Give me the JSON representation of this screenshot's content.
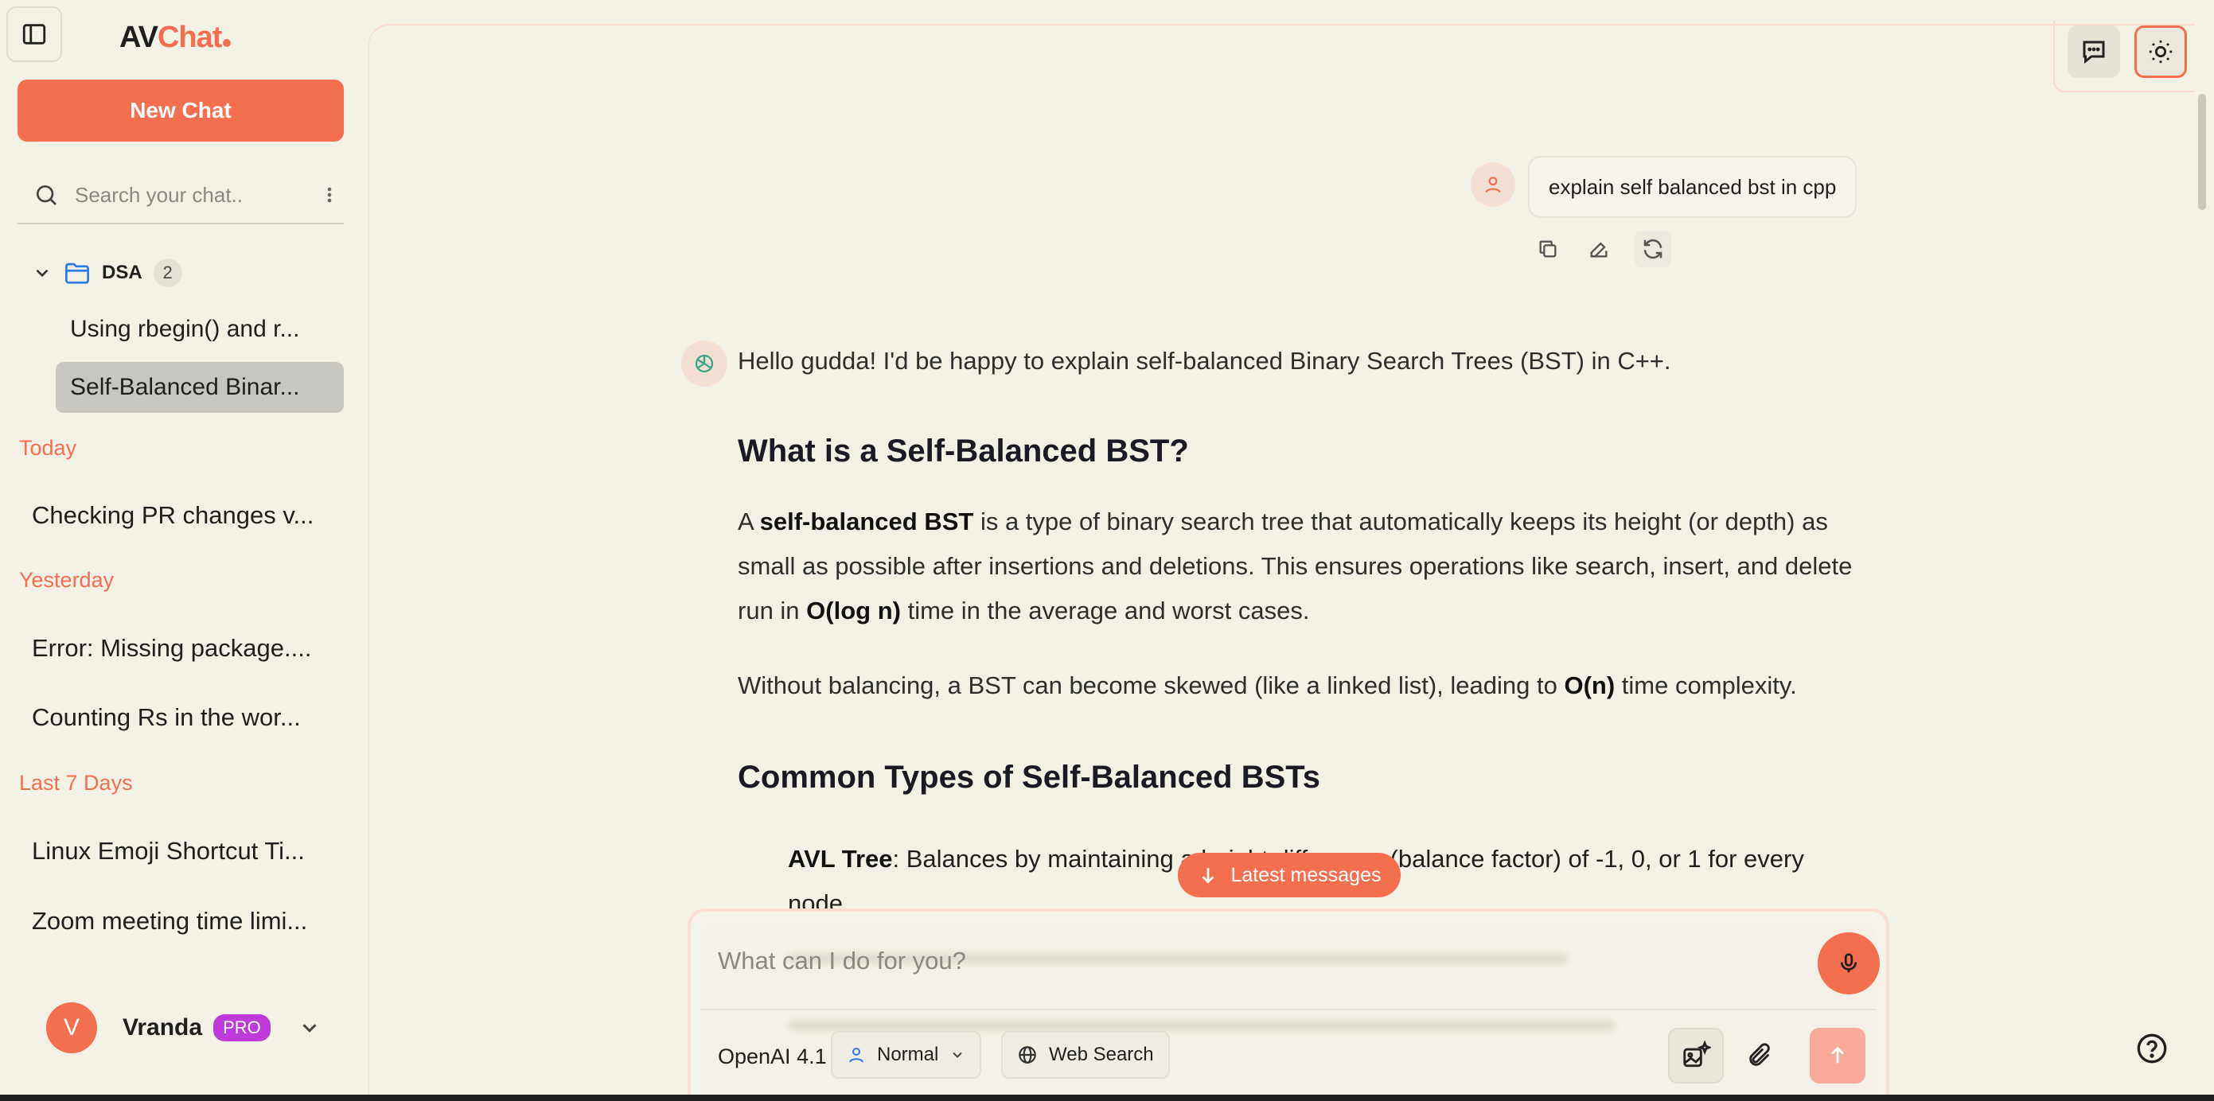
{
  "sidebar": {
    "logo_main": "AV",
    "logo_accent": "Chat",
    "new_chat_label": "New Chat",
    "search_placeholder": "Search your chat..",
    "folder": {
      "label": "DSA",
      "count": "2",
      "items": [
        {
          "label": "Using rbegin() and r..."
        },
        {
          "label": "Self-Balanced Binar..."
        }
      ]
    },
    "sections": [
      {
        "label": "Today",
        "items": [
          "Checking PR changes v..."
        ]
      },
      {
        "label": "Yesterday",
        "items": [
          "Error: Missing package....",
          "Counting Rs in the wor..."
        ]
      },
      {
        "label": "Last 7 Days",
        "items": [
          "Linux Emoji Shortcut Ti...",
          "Zoom meeting time limi..."
        ]
      }
    ],
    "user": {
      "initial": "V",
      "name": "Vranda",
      "badge": "PRO"
    }
  },
  "chat": {
    "user_message": "explain self balanced bst in cpp",
    "intro": "Hello gudda! I'd be happy to explain self-balanced Binary Search Trees (BST) in C++.",
    "heading1": "What is a Self-Balanced BST?",
    "p1_a": "A ",
    "p1_bold": "self-balanced BST",
    "p1_b": " is a type of binary search tree that automatically keeps its height (or depth) as small as possible after insertions and deletions. This ensures operations like search, insert, and delete run in ",
    "p1_bold2": "O(log n)",
    "p1_c": " time in the average and worst cases.",
    "p2_a": "Without balancing, a BST can become skewed (like a linked list), leading to ",
    "p2_bold": "O(n)",
    "p2_b": " time complexity.",
    "heading2": "Common Types of Self-Balanced BSTs",
    "bullet1_bold": "AVL Tree",
    "bullet1_text": ": Balances by maintaining a height difference (balance factor) of -1, 0, or 1 for every node.",
    "latest_label": "Latest messages"
  },
  "composer": {
    "placeholder": "What can I do for you?",
    "model": "OpenAI 4.1 Mini",
    "mode": "Normal",
    "web_search": "Web Search"
  },
  "colors": {
    "accent": "#f46e50",
    "background": "#f3f0e6",
    "pro_badge": "#c03ad9"
  }
}
